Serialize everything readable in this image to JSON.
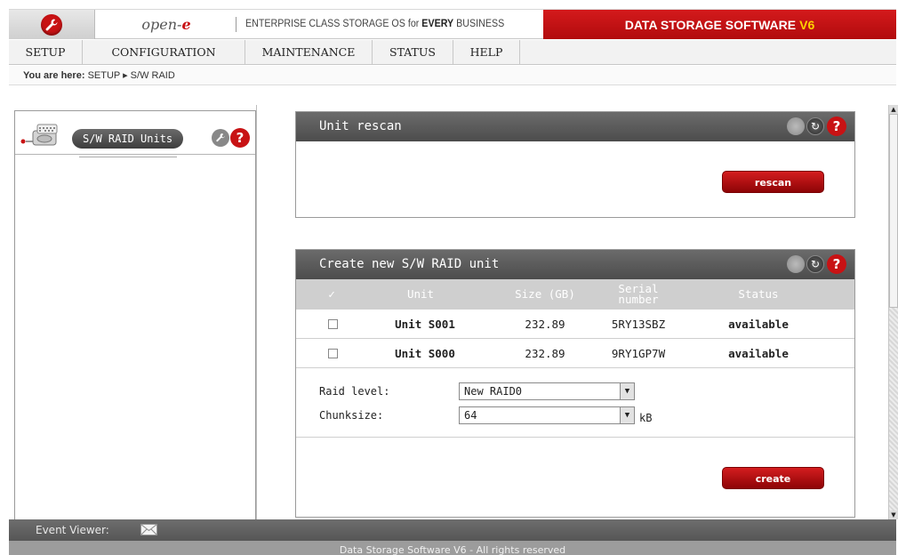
{
  "header": {
    "brand_prefix": "open-",
    "brand_suffix": "e",
    "tagline_prefix": "ENTERPRISE CLASS STORAGE OS for ",
    "tagline_bold": "EVERY",
    "tagline_suffix": " BUSINESS",
    "product_title": "DATA STORAGE SOFTWARE",
    "product_version": "V6",
    "accent_color": "#c81214",
    "version_color": "#ffd200"
  },
  "menu": {
    "setup": "SETUP",
    "configuration": "CONFIGURATION",
    "maintenance": "MAINTENANCE",
    "status": "STATUS",
    "help": "HELP"
  },
  "breadcrumb": {
    "prefix": "You are here:",
    "path": "SETUP ▸ S/W RAID"
  },
  "sidebar": {
    "tab_label": "S/W RAID Units",
    "help_glyph": "?"
  },
  "rescan_panel": {
    "title": "Unit rescan",
    "button_label": "rescan"
  },
  "create_panel": {
    "title": "Create new S/W RAID unit",
    "columns": {
      "check": "✓",
      "unit": "Unit",
      "size": "Size (GB)",
      "serial_line1": "Serial",
      "serial_line2": "number",
      "status": "Status"
    },
    "rows": [
      {
        "unit": "Unit S001",
        "size": "232.89",
        "serial": "5RY13SBZ",
        "status": "available",
        "checked": false
      },
      {
        "unit": "Unit S000",
        "size": "232.89",
        "serial": "9RY1GP7W",
        "status": "available",
        "checked": false
      }
    ],
    "raid_level_label": "Raid level:",
    "raid_level_value": "New RAID0",
    "chunksize_label": "Chunksize:",
    "chunksize_value": "64",
    "chunksize_unit": "kB",
    "button_label": "create"
  },
  "event_viewer": {
    "label": "Event Viewer:"
  },
  "footer": {
    "text": "Data Storage Software V6 - All rights reserved"
  },
  "icons": {
    "header_logo": "wrench-icon",
    "panel_gear": "gear-icon",
    "panel_refresh": "refresh-icon",
    "panel_help": "help-icon",
    "event_mail": "mail-icon"
  }
}
